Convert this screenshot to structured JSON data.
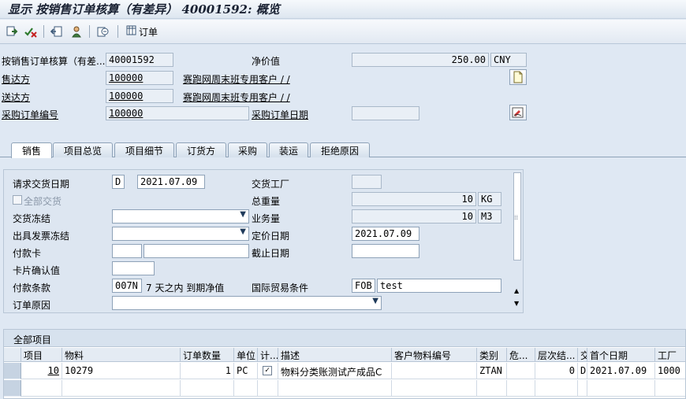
{
  "title": "显示 按销售订单核算（有差异） 40001592: 概览",
  "toolbar": {
    "order_label": "订单"
  },
  "header": {
    "doc_label": "按销售订单核算（有差...",
    "doc_value": "40001592",
    "net_label": "净价值",
    "net_value": "250.00",
    "currency": "CNY",
    "soldto_label": "售达方",
    "soldto_value": "100000",
    "soldto_name": "赛跑网周末班专用客户 / /",
    "shipto_label": "送达方",
    "shipto_value": "100000",
    "shipto_name": "赛跑网周末班专用客户 / /",
    "po_label": "采购订单编号",
    "po_value": "100000",
    "po_date_label": "采购订单日期",
    "po_date_value": ""
  },
  "tabs": [
    "销售",
    "项目总览",
    "项目细节",
    "订货方",
    "采购",
    "装运",
    "拒绝原因"
  ],
  "sales": {
    "req_date_label": "请求交货日期",
    "req_date_type": "D",
    "req_date_value": "2021.07.09",
    "plant_label": "交货工厂",
    "plant_value": "",
    "complete_label": "全部交货",
    "weight_label": "总重量",
    "weight_value": "10",
    "weight_unit": "KG",
    "delblock_label": "交货冻结",
    "volume_label": "业务量",
    "volume_value": "10",
    "volume_unit": "M3",
    "billblock_label": "出具发票冻结",
    "pricedate_label": "定价日期",
    "pricedate_value": "2021.07.09",
    "card_label": "付款卡",
    "expiry_label": "截止日期",
    "cardverif_label": "卡片确认值",
    "terms_label": "付款条款",
    "terms_code": "007N",
    "terms_text": "7 天之内 到期净值",
    "inco_label": "国际贸易条件",
    "inco_code": "FOB",
    "inco_text": "test",
    "reason_label": "订单原因"
  },
  "items": {
    "title": "全部项目",
    "columns": [
      "项目",
      "物料",
      "订单数量",
      "单位",
      "计...",
      "描述",
      "客户物料编号",
      "类别",
      "危...",
      "层次结...",
      "交",
      "首个日期",
      "工厂"
    ],
    "rows": [
      {
        "item": "10",
        "material": "10279",
        "qty": "1",
        "unit": "PC",
        "checked": "✓",
        "desc": "物料分类账测试产成品C",
        "cust_mat": "",
        "category": "ZTAN",
        "hazard": "",
        "hier": "0",
        "del": "D",
        "first_date": "2021.07.09",
        "plant": "1000"
      }
    ]
  }
}
